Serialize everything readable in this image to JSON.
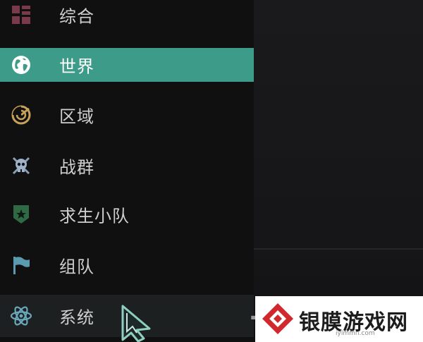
{
  "menu": {
    "items": [
      {
        "id": "general",
        "label": "综合",
        "icon": "grid-icon"
      },
      {
        "id": "world",
        "label": "世界",
        "icon": "globe-icon",
        "active": true
      },
      {
        "id": "region",
        "label": "区域",
        "icon": "radar-icon"
      },
      {
        "id": "warband",
        "label": "战群",
        "icon": "skull-icon"
      },
      {
        "id": "survival_squad",
        "label": "求生小队",
        "icon": "shield-star-icon"
      },
      {
        "id": "team",
        "label": "组队",
        "icon": "flag-icon"
      },
      {
        "id": "system",
        "label": "系统",
        "icon": "atom-icon"
      }
    ]
  },
  "colors": {
    "active_bg": "#3c9b89",
    "menu_bg": "#101011",
    "label": "#cfcfcf"
  },
  "watermark": {
    "name": "银膜游戏网",
    "site": "iylmmn.com",
    "logo_icon": "watermark-logo-icon"
  }
}
